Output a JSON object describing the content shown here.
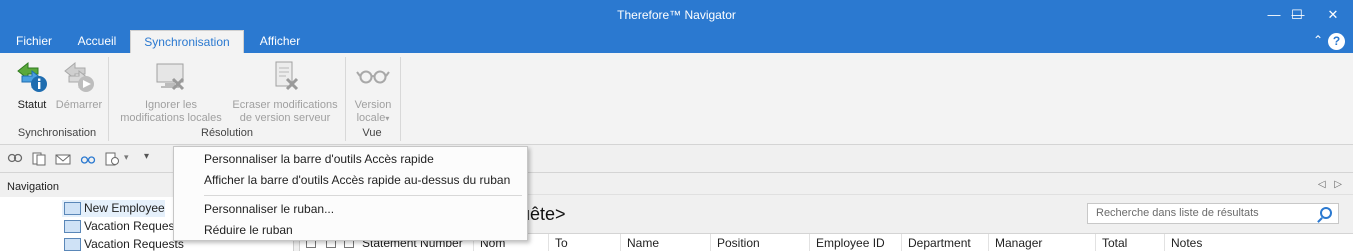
{
  "window": {
    "title": "Therefore™ Navigator",
    "minimize_glyph": "—",
    "maximize_glyph": "☐",
    "close_glyph": "✕"
  },
  "tabs": [
    {
      "label": "Fichier"
    },
    {
      "label": "Accueil"
    },
    {
      "label": "Synchronisation"
    },
    {
      "label": "Afficher"
    }
  ],
  "tabstrip": {
    "collapse_glyph": "⌃",
    "help_glyph": "?"
  },
  "ribbon": {
    "buttons": [
      {
        "label_line1": "Statut",
        "label_line2": "",
        "enabled": true,
        "icon": "sync-status-icon"
      },
      {
        "label_line1": "Démarrer",
        "label_line2": "",
        "enabled": false,
        "icon": "start-sync-icon"
      },
      {
        "label_line1": "Ignorer les",
        "label_line2": "modifications locales",
        "enabled": false,
        "icon": "ignore-local-icon"
      },
      {
        "label_line1": "Ecraser modifications",
        "label_line2": "de version serveur",
        "enabled": false,
        "icon": "overwrite-server-icon"
      },
      {
        "label_line1": "Version",
        "label_line2": "locale",
        "enabled": false,
        "icon": "glasses-icon",
        "dropdown_glyph": "▾"
      }
    ],
    "groups": [
      {
        "label": "Synchronisation"
      },
      {
        "label": "Résolution"
      },
      {
        "label": "Vue"
      }
    ]
  },
  "qat": {
    "dropdown_glyph": "▾",
    "customize_glyph": "▾"
  },
  "context_menu": {
    "items": [
      {
        "label": "Personnaliser la barre d'outils Accès rapide"
      },
      {
        "label": "Afficher la barre d'outils Accès rapide au-dessus du ruban"
      },
      {
        "label": "Personnaliser le ruban..."
      },
      {
        "label": "Réduire le ruban"
      }
    ]
  },
  "navigation": {
    "header": "Navigation",
    "items": [
      {
        "label": "New Employee"
      },
      {
        "label": "Vacation Request"
      },
      {
        "label": "Vacation Requests"
      }
    ]
  },
  "content": {
    "query_title": "quête>",
    "nav_prev_glyph": "◁",
    "nav_next_glyph": "▷",
    "search_placeholder": "Recherche dans liste de résultats",
    "columns": [
      {
        "label": "Statement Number"
      },
      {
        "label": "Nom"
      },
      {
        "label": "To"
      },
      {
        "label": "Name"
      },
      {
        "label": "Position"
      },
      {
        "label": "Employee ID"
      },
      {
        "label": "Department"
      },
      {
        "label": "Manager"
      },
      {
        "label": "Total"
      },
      {
        "label": "Notes"
      }
    ]
  },
  "colors": {
    "titlebar": "#2b79d0",
    "accent": "#2b79d0",
    "ribbon_bg": "#f3f3f3"
  }
}
